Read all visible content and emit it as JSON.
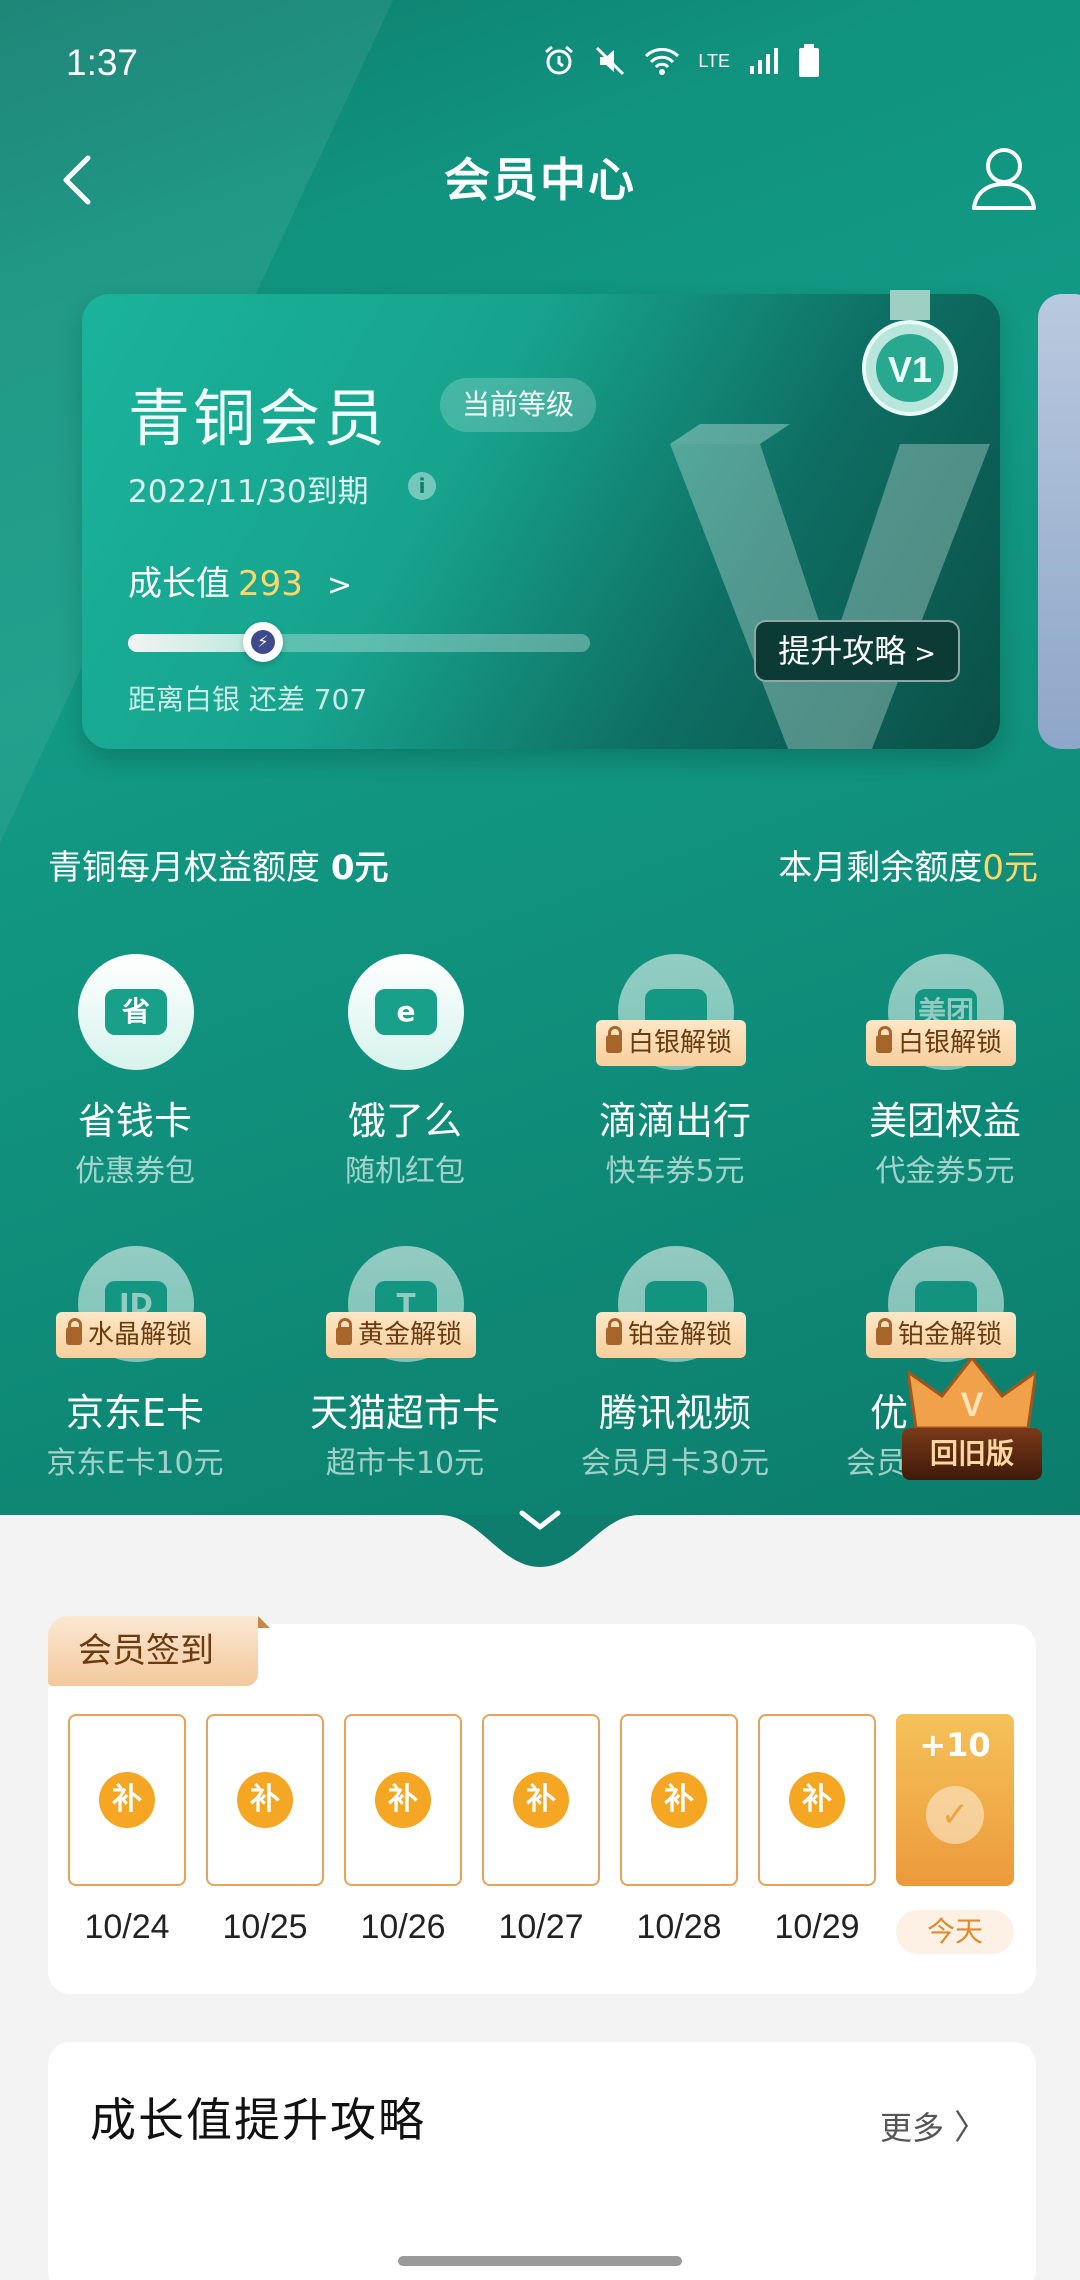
{
  "status_bar": {
    "time": "1:37",
    "icons": [
      "alarm-icon",
      "mute-icon",
      "wifi-icon",
      "lte-icon",
      "signal-icon",
      "battery-icon"
    ],
    "lte_label": "LTE"
  },
  "nav": {
    "title": "会员中心"
  },
  "member_card": {
    "level_name": "青铜会员",
    "badge": "当前等级",
    "expire": "2022/11/30到期",
    "growth_label": "成长值",
    "growth_value": "293",
    "growth_progress": 0.293,
    "remaining_text": "距离白银 还差 707",
    "upgrade_button": "提升攻略",
    "medal_text": "V1"
  },
  "quota": {
    "left_label": "青铜每月权益额度 ",
    "left_value": "0元",
    "right_label": "本月剩余额度",
    "right_value": "0元"
  },
  "benefits": [
    {
      "name": "省钱卡",
      "sub": "优惠券包",
      "icon_text": "省",
      "lock": ""
    },
    {
      "name": "饿了么",
      "sub": "随机红包",
      "icon_text": "e",
      "lock": ""
    },
    {
      "name": "滴滴出行",
      "sub": "快车券5元",
      "icon_text": "",
      "lock": "白银解锁"
    },
    {
      "name": "美团权益",
      "sub": "代金券5元",
      "icon_text": "美团",
      "lock": "白银解锁"
    },
    {
      "name": "京东E卡",
      "sub": "京东E卡10元",
      "icon_text": "JD",
      "lock": "水晶解锁"
    },
    {
      "name": "天猫超市卡",
      "sub": "超市卡10元",
      "icon_text": "T",
      "lock": "黄金解锁"
    },
    {
      "name": "腾讯视频",
      "sub": "会员月卡30元",
      "icon_text": "",
      "lock": "铂金解锁"
    },
    {
      "name": "优",
      "sub": "会员",
      "icon_text": "",
      "lock": "铂金解锁"
    }
  ],
  "old_version_button": "回旧版",
  "signin": {
    "title": "会员签到",
    "days": [
      {
        "date": "10/24",
        "coin": "补"
      },
      {
        "date": "10/25",
        "coin": "补"
      },
      {
        "date": "10/26",
        "coin": "补"
      },
      {
        "date": "10/27",
        "coin": "补"
      },
      {
        "date": "10/28",
        "coin": "补"
      },
      {
        "date": "10/29",
        "coin": "补"
      }
    ],
    "today": {
      "bonus": "+10",
      "label": "今天"
    }
  },
  "guide": {
    "title": "成长值提升攻略",
    "more": "更多"
  },
  "colors": {
    "teal": "#129a85",
    "gold": "#ffd769",
    "orange": "#f5a623"
  }
}
